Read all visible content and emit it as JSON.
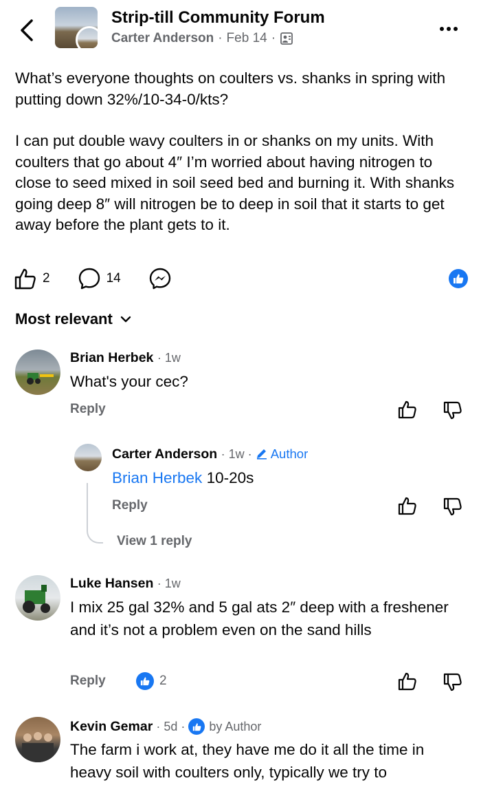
{
  "header": {
    "group_name": "Strip-till Community Forum",
    "author": "Carter Anderson",
    "separator": "·",
    "date": "Feb 14",
    "privacy_icon": "members-icon",
    "back_icon": "chevron-left-icon",
    "more_icon": "ellipsis-icon"
  },
  "post": {
    "paragraphs": [
      "What’s everyone thoughts on coulters vs. shanks in spring with putting down 32%/10-34-0/kts?",
      "I can put double wavy coulters in or shanks on my units. With coulters that go about 4″ I’m worried about having nitrogen to close to seed mixed in soil seed bed and burning it. With shanks going deep 8″ will nitrogen be to deep in soil that it starts to get away before the plant gets to it."
    ],
    "likes": "2",
    "comments": "14",
    "like_icon": "thumbs-up-icon",
    "comment_icon": "comment-bubble-icon",
    "messenger_icon": "messenger-icon",
    "reaction_badge": "like-reaction-icon"
  },
  "sort_label": "Most relevant",
  "comments": [
    {
      "name": "Brian Herbek",
      "time": "1w",
      "text": "What's your cec?",
      "reply_label": "Reply"
    },
    {
      "name": "Carter Anderson",
      "time": "1w",
      "author_label": "Author",
      "mention": "Brian Herbek",
      "text": " 10-20s",
      "reply_label": "Reply",
      "view_replies": "View 1 reply"
    },
    {
      "name": "Luke Hansen",
      "time": "1w",
      "text": "I mix 25 gal 32% and 5 gal ats 2″ deep with a freshener and it’s not a problem even on the sand hills",
      "reply_label": "Reply",
      "reactions": "2"
    },
    {
      "name": "Kevin Gemar",
      "time": "5d",
      "liked_by": "by Author",
      "text": "The farm i work at, they have me do it all the time in heavy soil with coulters only, typically we try to",
      "reply_label": "Reply"
    }
  ],
  "colors": {
    "accent": "#1877f2",
    "secondary_text": "#65676b",
    "primary_text": "#050505"
  }
}
